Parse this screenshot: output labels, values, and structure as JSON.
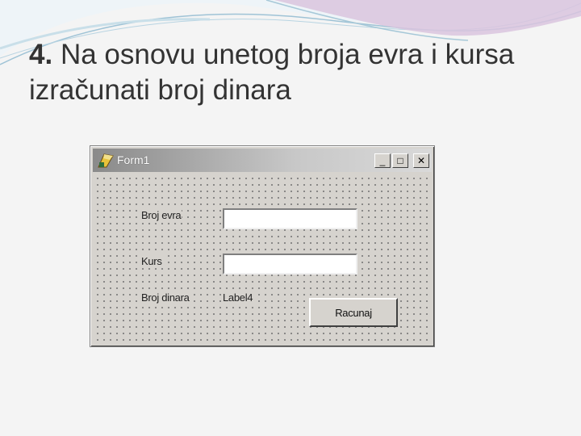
{
  "slide": {
    "title_number": "4.",
    "title_text": "Na osnovu unetog broja evra i kursa izračunati broj dinara"
  },
  "window": {
    "title": "Form1",
    "controls": {
      "minimize_glyph": "_",
      "maximize_glyph": "□",
      "close_glyph": "✕"
    }
  },
  "form": {
    "label_euros": "Broj evra",
    "input_euros_value": "",
    "label_rate": "Kurs",
    "input_rate_value": "",
    "label_dinars": "Broj dinara",
    "result_label": "Label4",
    "calculate_button": "Racunaj"
  },
  "icons": {
    "app": "delphi-app-icon",
    "minimize": "minimize-icon",
    "maximize": "maximize-icon",
    "close": "close-icon"
  }
}
